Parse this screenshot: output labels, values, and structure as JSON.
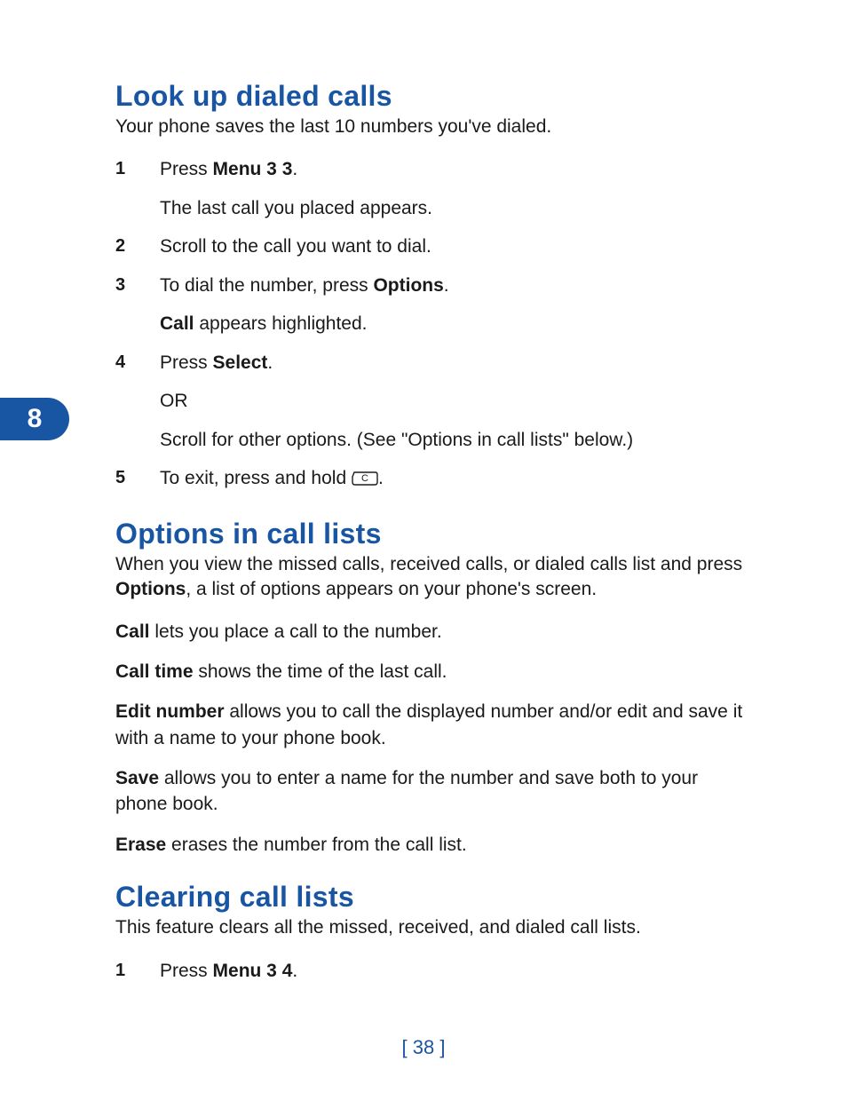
{
  "chapter_tab": "8",
  "page_number": "[ 38 ]",
  "sections": [
    {
      "heading": "Look up dialed calls",
      "intro": "Your phone saves the last 10 numbers you've dialed.",
      "steps": [
        {
          "num": "1",
          "lines": [
            {
              "parts": [
                {
                  "t": "Press "
                },
                {
                  "t": "Menu 3 3",
                  "b": true
                },
                {
                  "t": "."
                }
              ]
            },
            {
              "parts": [
                {
                  "t": "The last call you placed appears."
                }
              ]
            }
          ]
        },
        {
          "num": "2",
          "lines": [
            {
              "parts": [
                {
                  "t": "Scroll to the call you want to dial."
                }
              ]
            }
          ]
        },
        {
          "num": "3",
          "lines": [
            {
              "parts": [
                {
                  "t": "To dial the number, press "
                },
                {
                  "t": "Options",
                  "b": true
                },
                {
                  "t": "."
                }
              ]
            },
            {
              "parts": [
                {
                  "t": "Call",
                  "b": true
                },
                {
                  "t": " appears highlighted."
                }
              ]
            }
          ]
        },
        {
          "num": "4",
          "lines": [
            {
              "parts": [
                {
                  "t": "Press "
                },
                {
                  "t": "Select",
                  "b": true
                },
                {
                  "t": "."
                }
              ]
            },
            {
              "parts": [
                {
                  "t": "OR"
                }
              ]
            },
            {
              "parts": [
                {
                  "t": "Scroll for other options. (See \"Options in call lists\" below.)"
                }
              ]
            }
          ]
        },
        {
          "num": "5",
          "lines": [
            {
              "parts": [
                {
                  "t": "To exit, press and hold "
                },
                {
                  "icon": "c-key"
                },
                {
                  "t": "."
                }
              ]
            }
          ]
        }
      ]
    },
    {
      "heading": "Options in call lists",
      "intro_rich": {
        "parts": [
          {
            "t": "When you view the missed calls, received calls, or dialed calls list and press "
          },
          {
            "t": "Options",
            "b": true
          },
          {
            "t": ", a list of options appears on your phone's screen."
          }
        ]
      },
      "paras": [
        {
          "parts": [
            {
              "t": "Call",
              "b": true
            },
            {
              "t": " lets you place a call to the number."
            }
          ]
        },
        {
          "parts": [
            {
              "t": "Call time",
              "b": true
            },
            {
              "t": " shows the time of the last call."
            }
          ]
        },
        {
          "parts": [
            {
              "t": "Edit number",
              "b": true
            },
            {
              "t": " allows you to call the displayed number and/or edit and save it with a name to your phone book."
            }
          ]
        },
        {
          "parts": [
            {
              "t": "Save",
              "b": true
            },
            {
              "t": " allows you to enter a name for the number and save both to your phone book."
            }
          ]
        },
        {
          "parts": [
            {
              "t": "Erase",
              "b": true
            },
            {
              "t": " erases the number from the call list."
            }
          ]
        }
      ]
    },
    {
      "heading": "Clearing call lists",
      "intro": "This feature clears all the missed, received, and dialed call lists.",
      "steps": [
        {
          "num": "1",
          "lines": [
            {
              "parts": [
                {
                  "t": "Press "
                },
                {
                  "t": "Menu 3 4",
                  "b": true
                },
                {
                  "t": "."
                }
              ]
            }
          ]
        }
      ]
    }
  ]
}
